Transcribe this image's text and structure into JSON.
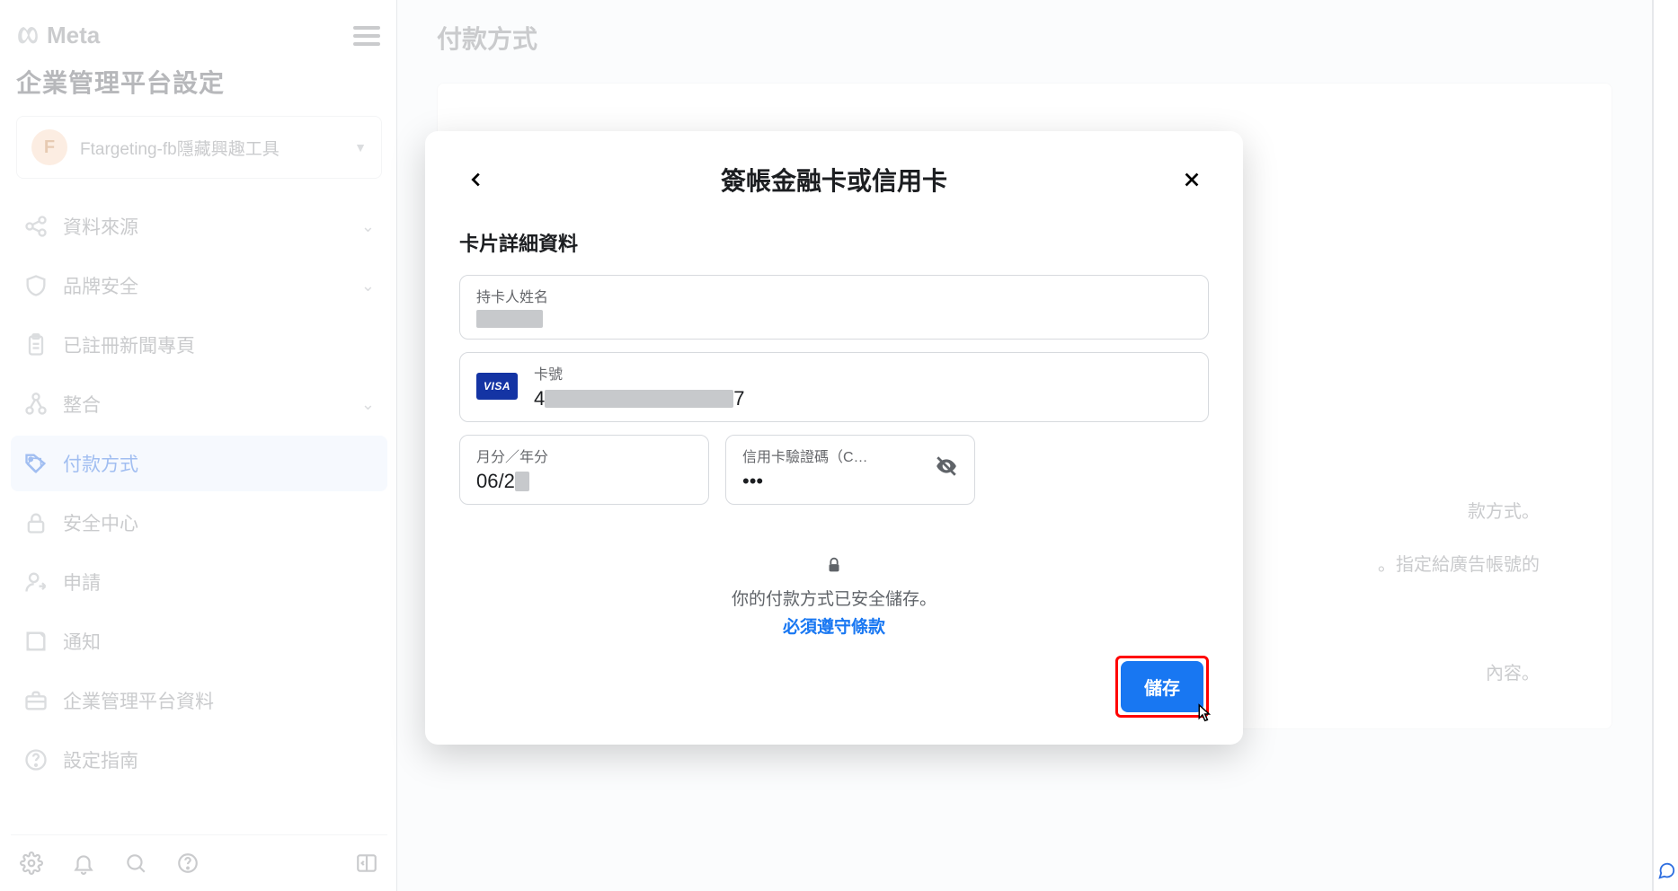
{
  "brand": {
    "name": "Meta"
  },
  "sidebar": {
    "title": "企業管理平台設定",
    "account": {
      "initial": "F",
      "name": "Ftargeting-fb隱藏興趣工具"
    },
    "items": [
      {
        "label": "資料來源",
        "icon": "share-nodes-icon",
        "expandable": true,
        "active": false
      },
      {
        "label": "品牌安全",
        "icon": "shield-icon",
        "expandable": true,
        "active": false
      },
      {
        "label": "已註冊新聞專頁",
        "icon": "clipboard-icon",
        "expandable": false,
        "active": false
      },
      {
        "label": "整合",
        "icon": "nodes-icon",
        "expandable": true,
        "active": false
      },
      {
        "label": "付款方式",
        "icon": "tag-icon",
        "expandable": false,
        "active": true
      },
      {
        "label": "安全中心",
        "icon": "lock-icon",
        "expandable": false,
        "active": false
      },
      {
        "label": "申請",
        "icon": "user-arrow-icon",
        "expandable": false,
        "active": false
      },
      {
        "label": "通知",
        "icon": "note-icon",
        "expandable": false,
        "active": false
      },
      {
        "label": "企業管理平台資料",
        "icon": "briefcase-icon",
        "expandable": false,
        "active": false
      },
      {
        "label": "設定指南",
        "icon": "question-circle-icon",
        "expandable": false,
        "active": false
      }
    ]
  },
  "main": {
    "title": "付款方式",
    "hint_suffix_1": "款方式。",
    "hint_suffix_2": "。指定給廣告帳號的",
    "hint_suffix_3": "內容。"
  },
  "modal": {
    "title": "簽帳金融卡或信用卡",
    "subheader": "卡片詳細資料",
    "cardholder_label": "持卡人姓名",
    "card_number_label": "卡號",
    "card_number_prefix": "4",
    "card_number_suffix": "7",
    "card_brand": "VISA",
    "expiry_label": "月分／年分",
    "expiry_prefix": "06/2",
    "cvv_label": "信用卡驗證碼（C…",
    "cvv_value": "•••",
    "secure_text": "你的付款方式已安全儲存。",
    "terms_link": "必須遵守條款",
    "save_label": "儲存"
  }
}
